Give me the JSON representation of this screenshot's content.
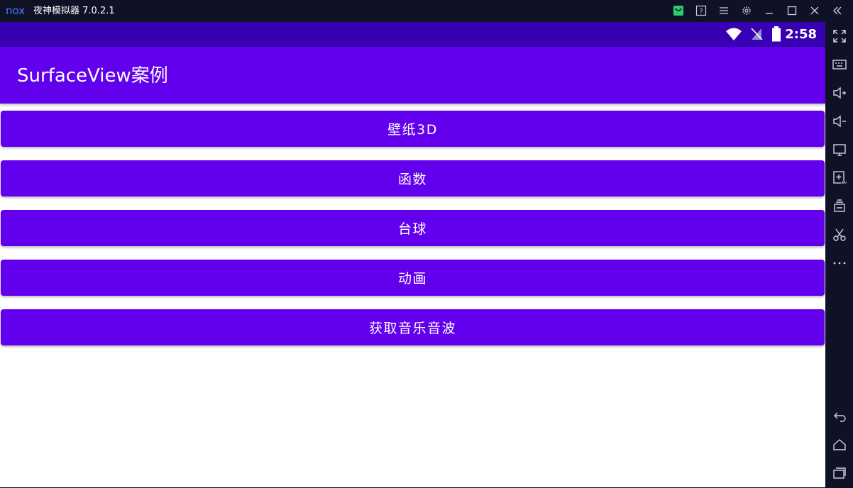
{
  "window": {
    "logo_text": "nox",
    "title": "夜神模拟器 7.0.2.1"
  },
  "statusbar": {
    "time": "2:58"
  },
  "app": {
    "title": "SurfaceView案例",
    "buttons": [
      {
        "label": "壁纸3D"
      },
      {
        "label": "函数"
      },
      {
        "label": "台球"
      },
      {
        "label": "动画"
      },
      {
        "label": "获取音乐音波"
      }
    ]
  },
  "colors": {
    "primary": "#6200ee",
    "primary_dark": "#3700b3",
    "chrome": "#0f1126",
    "accent_green": "#2ecc71"
  }
}
